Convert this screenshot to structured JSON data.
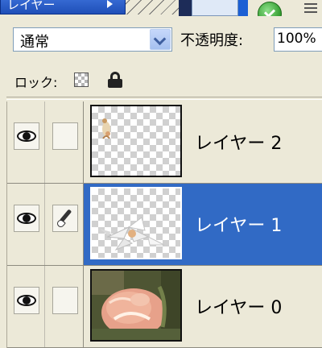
{
  "tab": {
    "title": "レイヤー"
  },
  "options": {
    "blend_mode": "通常",
    "opacity_label": "不透明度:",
    "opacity_value": "100%"
  },
  "lock": {
    "label": "ロック:"
  },
  "layers": [
    {
      "name": "レイヤー 2",
      "visible": true,
      "selected": false,
      "brush": false
    },
    {
      "name": "レイヤー 1",
      "visible": true,
      "selected": true,
      "brush": true
    },
    {
      "name": "レイヤー 0",
      "visible": true,
      "selected": false,
      "brush": false
    }
  ],
  "colors": {
    "selection": "#316ac5",
    "panel": "#ece9d8",
    "tab": "#1f4fb8"
  },
  "icons": [
    "panel-menu-arrow-icon",
    "go-icon",
    "panel-menu-icon",
    "lock-transparency-icon",
    "lock-all-icon",
    "eye-icon",
    "brush-icon",
    "dropdown-arrow-icon"
  ]
}
